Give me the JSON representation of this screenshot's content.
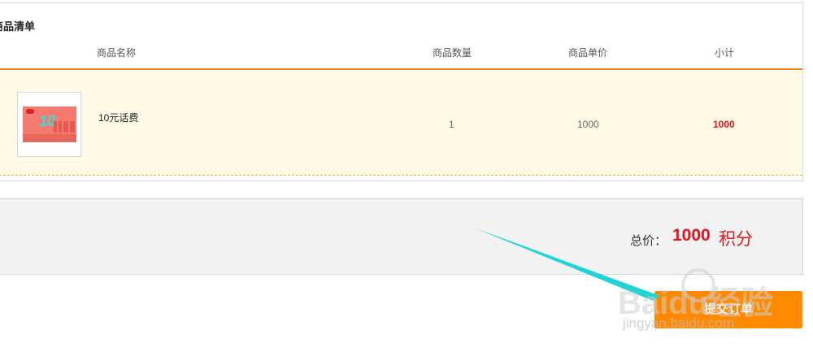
{
  "order_list": {
    "title": "商品清单",
    "columns": {
      "name": "商品名称",
      "quantity": "商品数量",
      "price": "商品单价",
      "subtotal": "小计"
    },
    "items": [
      {
        "name": "10元话费",
        "quantity": "1",
        "price": "1000",
        "subtotal": "1000",
        "thumbnail_text": "10"
      }
    ]
  },
  "summary": {
    "total_label": "总价：",
    "total_value": "1000",
    "total_unit": "积分"
  },
  "actions": {
    "submit_label": "提交订单"
  },
  "watermark": {
    "brand": "Baidu经验",
    "url": "jingyan.baidu.com"
  },
  "colors": {
    "accent_orange": "#ff8a00",
    "header_line": "#f08a24",
    "price_red": "#e4131c",
    "row_highlight": "#fffae6",
    "annotation_arrow": "#1fd3d6"
  }
}
